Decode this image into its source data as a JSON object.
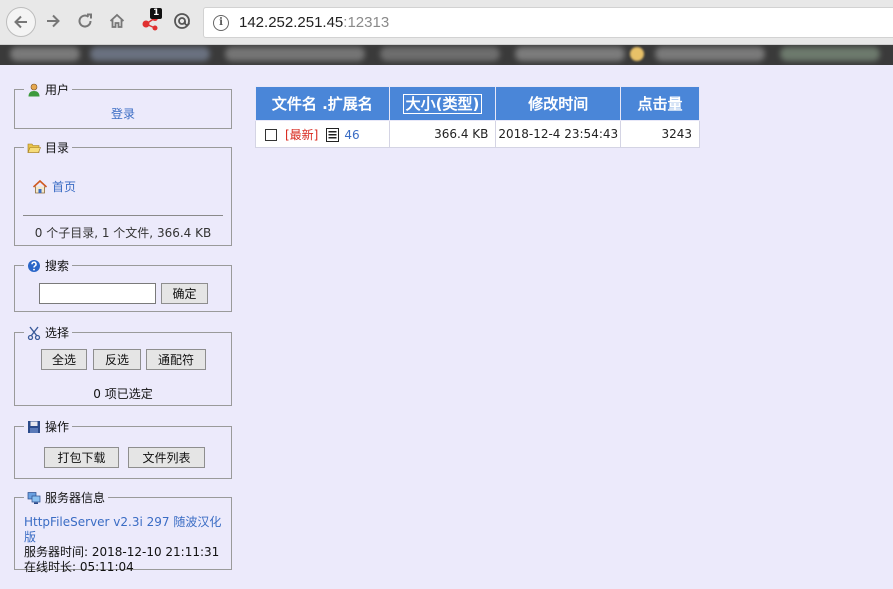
{
  "browser": {
    "url_host": "142.252.251.45",
    "url_port": ":12313",
    "extension_badge": "1"
  },
  "sidebar": {
    "user": {
      "legend": "用户",
      "login_label": "登录"
    },
    "directory": {
      "legend": "目录",
      "home_label": "首页",
      "stats": "0 个子目录, 1 个文件, 366.4 KB"
    },
    "search": {
      "legend": "搜索",
      "input_value": "",
      "ok_label": "确定"
    },
    "selection": {
      "legend": "选择",
      "select_all": "全选",
      "invert": "反选",
      "wildcard": "通配符",
      "count": "0 项已选定"
    },
    "operations": {
      "legend": "操作",
      "zip_download": "打包下载",
      "file_list": "文件列表"
    },
    "server": {
      "legend": "服务器信息",
      "software": "HttpFileServer v2.3i 297 随波汉化版",
      "server_time": "服务器时间: 2018-12-10 21:11:31",
      "uptime": "在线时长: 05:11:04"
    }
  },
  "table": {
    "headers": {
      "name": "文件名 .扩展名",
      "size": "大小(类型)",
      "modified": "修改时间",
      "hits": "点击量"
    },
    "rows": [
      {
        "new_tag": "[最新]",
        "name": "46",
        "size": "366.4 KB",
        "modified": "2018-12-4 23:54:43",
        "hits": "3243"
      }
    ]
  }
}
